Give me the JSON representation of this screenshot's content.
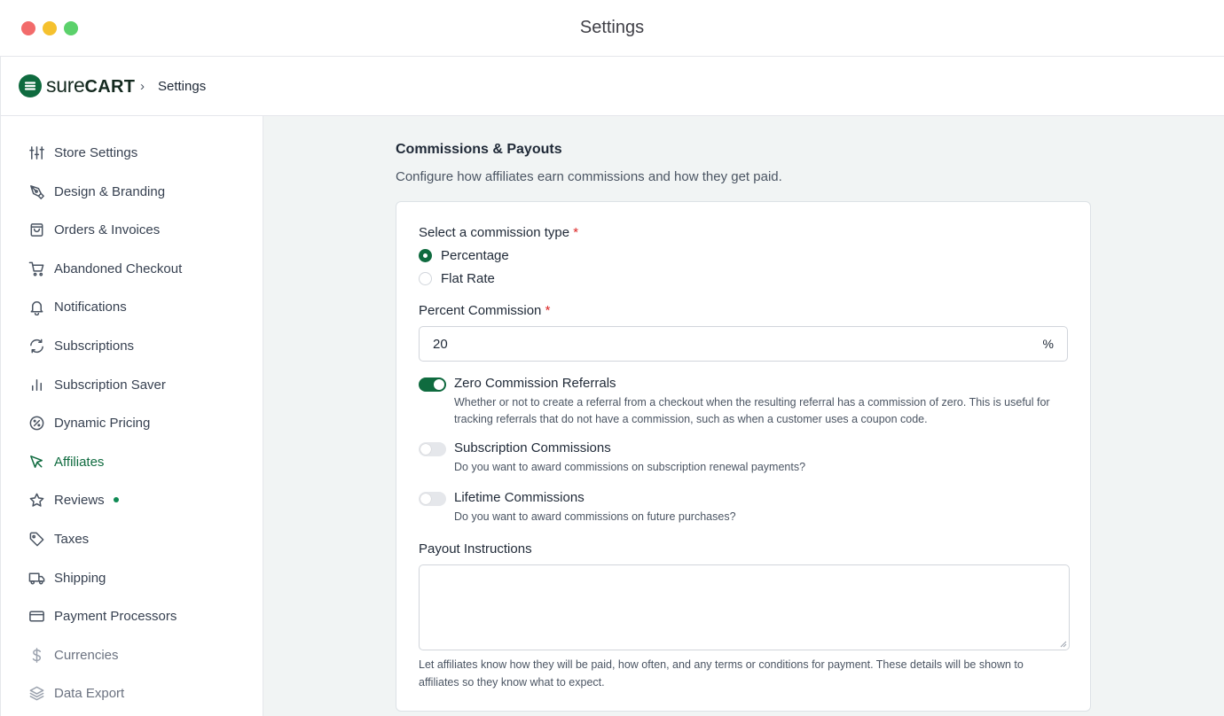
{
  "window": {
    "title": "Settings"
  },
  "header": {
    "brand_light": "sure",
    "brand_bold": "CART",
    "breadcrumb_separator": "›",
    "breadcrumb_current": "Settings"
  },
  "sidebar": {
    "items": [
      {
        "label": "Store Settings",
        "icon": "sliders-icon"
      },
      {
        "label": "Design & Branding",
        "icon": "pen-tool-icon"
      },
      {
        "label": "Orders & Invoices",
        "icon": "shopping-bag-icon"
      },
      {
        "label": "Abandoned Checkout",
        "icon": "shopping-cart-icon"
      },
      {
        "label": "Notifications",
        "icon": "bell-icon"
      },
      {
        "label": "Subscriptions",
        "icon": "refresh-icon"
      },
      {
        "label": "Subscription Saver",
        "icon": "bar-chart-icon"
      },
      {
        "label": "Dynamic Pricing",
        "icon": "percent-badge-icon"
      },
      {
        "label": "Affiliates",
        "icon": "cursor-arrow-icon",
        "active": true
      },
      {
        "label": "Reviews",
        "icon": "star-icon",
        "badge": "new-dot"
      },
      {
        "label": "Taxes",
        "icon": "tag-icon"
      },
      {
        "label": "Shipping",
        "icon": "truck-icon"
      },
      {
        "label": "Payment Processors",
        "icon": "credit-card-icon"
      },
      {
        "label": "Currencies",
        "icon": "dollar-icon"
      },
      {
        "label": "Data Export",
        "icon": "layers-icon"
      }
    ]
  },
  "main": {
    "title": "Commissions & Payouts",
    "description": "Configure how affiliates earn commissions and how they get paid.",
    "commission_type": {
      "label": "Select a commission type",
      "required_mark": "*",
      "options": [
        {
          "label": "Percentage",
          "selected": true
        },
        {
          "label": "Flat Rate",
          "selected": false
        }
      ]
    },
    "percent_commission": {
      "label": "Percent Commission",
      "required_mark": "*",
      "value": "20",
      "suffix": "%"
    },
    "toggles": [
      {
        "title": "Zero Commission Referrals",
        "description": "Whether or not to create a referral from a checkout when the resulting referral has a commission of zero. This is useful for tracking referrals that do not have a commission, such as when a customer uses a coupon code.",
        "on": true
      },
      {
        "title": "Subscription Commissions",
        "description": "Do you want to award commissions on subscription renewal payments?",
        "on": false
      },
      {
        "title": "Lifetime Commissions",
        "description": "Do you want to award commissions on future purchases?",
        "on": false
      }
    ],
    "payout_instructions": {
      "label": "Payout Instructions",
      "value": "",
      "help": "Let affiliates know how they will be paid, how often, and any terms or conditions for payment. These details will be shown to affiliates so they know what to expect."
    }
  },
  "colors": {
    "accent": "#0f6b3f",
    "required": "#dc2626",
    "main_bg": "#f1f4f4"
  }
}
